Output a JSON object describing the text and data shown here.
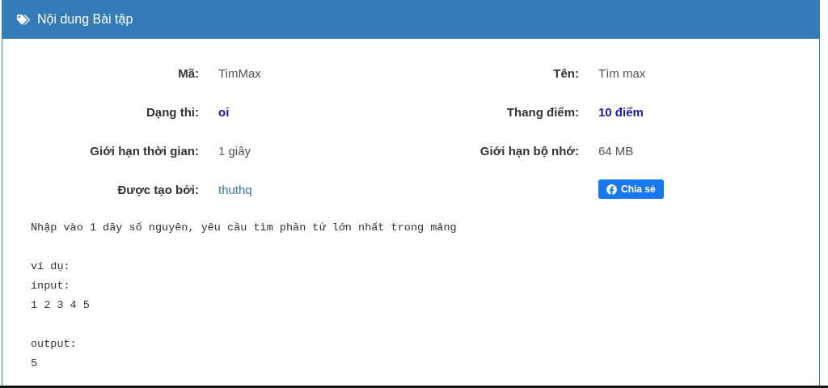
{
  "panel": {
    "title": "Nội dung Bài tập"
  },
  "fields": [
    {
      "label": "Mã:",
      "value": "TimMax",
      "kind": "plain"
    },
    {
      "label": "Tên:",
      "value": "Tìm max",
      "kind": "plain"
    },
    {
      "label": "Dạng thi:",
      "value": "oi",
      "kind": "strong"
    },
    {
      "label": "Thang điểm:",
      "value": "10 điểm",
      "kind": "strong"
    },
    {
      "label": "Giới hạn thời gian:",
      "value": "1 giây",
      "kind": "plain"
    },
    {
      "label": "Giới hạn bộ nhớ:",
      "value": "64 MB",
      "kind": "plain"
    },
    {
      "label": "Được tạo bởi:",
      "value": "thuthq",
      "kind": "link"
    },
    {
      "kind": "share",
      "value": "Chia sẻ"
    }
  ],
  "description": [
    "Nhập vào 1 dãy số nguyên, yêu cầu tìm phần tử lớn nhất trong mảng",
    "ví dụ:\ninput:\n1 2 3 4 5",
    "output:\n5"
  ]
}
